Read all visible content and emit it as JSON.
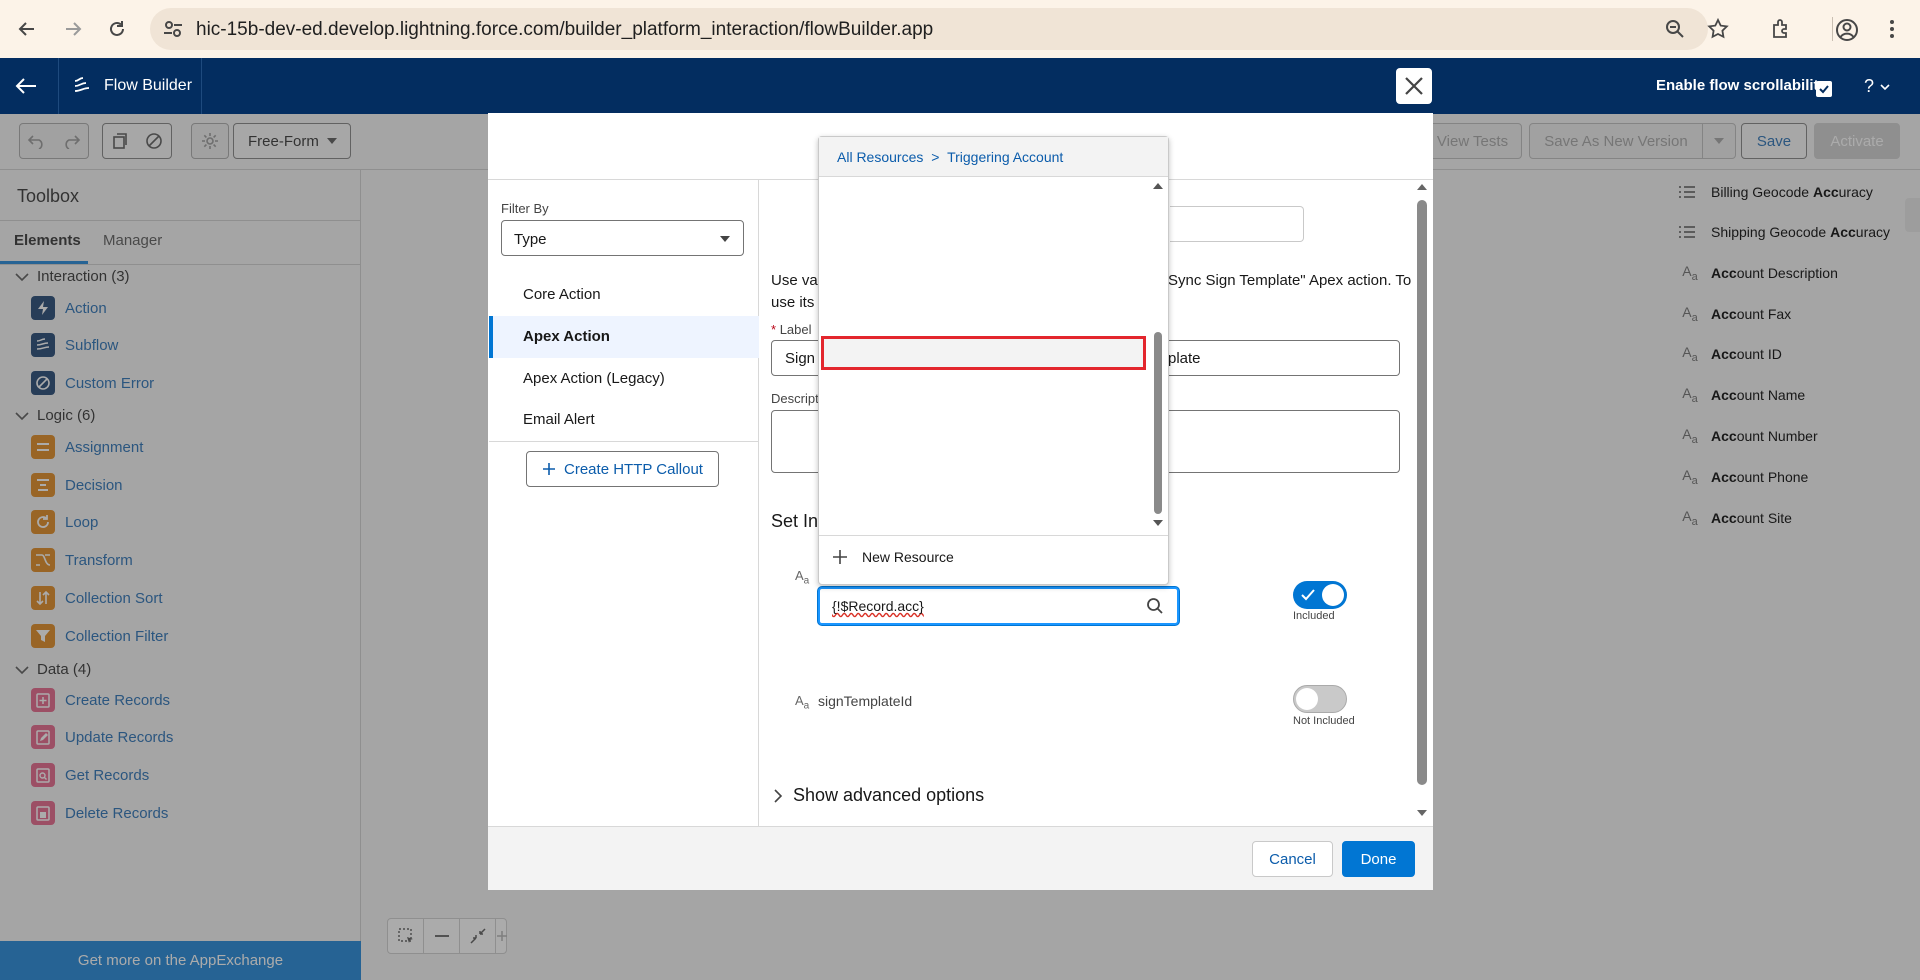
{
  "browser": {
    "url": "hic-15b-dev-ed.develop.lightning.force.com/builder_platform_interaction/flowBuilder.app"
  },
  "header": {
    "app_title": "Flow Builder",
    "scroll_label": "Enable flow scrollability",
    "help_label": "?"
  },
  "toolbar": {
    "layout_select": "Free-Form",
    "view_tests": "View Tests",
    "save_as_new": "Save As New Version",
    "save": "Save",
    "activate": "Activate"
  },
  "toolbox": {
    "title": "Toolbox",
    "tabs": [
      "Elements",
      "Manager"
    ],
    "sections": [
      {
        "label": "Interaction (3)",
        "items": [
          "Action",
          "Subflow",
          "Custom Error"
        ]
      },
      {
        "label": "Logic (6)",
        "items": [
          "Assignment",
          "Decision",
          "Loop",
          "Transform",
          "Collection Sort",
          "Collection Filter"
        ]
      },
      {
        "label": "Data (4)",
        "items": [
          "Create Records",
          "Update Records",
          "Get Records",
          "Delete Records"
        ]
      }
    ],
    "banner": "Get more on the AppExchange"
  },
  "modal": {
    "filter_by_label": "Filter By",
    "filter_value": "Type",
    "categories": [
      "Core Action",
      "Apex Action",
      "Apex Action (Legacy)",
      "Email Alert"
    ],
    "create_callout": "Create HTTP Callout",
    "desc_left": "Use val",
    "desc_left2": "use its",
    "desc_right": "Sync Sign Template\" Apex action. To",
    "label_field_label": "Label",
    "label_value_left": "Sign",
    "label_value_right": "plate",
    "description_label": "Descript",
    "set_inputs": "Set Inp",
    "input_value": "{!$Record.acc}",
    "included_label": "Included",
    "param2": "signTemplateId",
    "not_included_label": "Not Included",
    "advanced": "Show advanced options",
    "cancel": "Cancel",
    "done": "Done"
  },
  "dropdown": {
    "breadcrumb_root": "All Resources",
    "breadcrumb_sep": ">",
    "breadcrumb_current": "Triggering Account",
    "items": [
      {
        "icon": "list-icon",
        "pre": "Billing Geocode ",
        "match": "Acc",
        "post": "uracy"
      },
      {
        "icon": "list-icon",
        "pre": "Shipping Geocode ",
        "match": "Acc",
        "post": "uracy"
      },
      {
        "icon": "text-type-icon",
        "pre": "",
        "match": "Acc",
        "post": "ount Description"
      },
      {
        "icon": "text-type-icon",
        "pre": "",
        "match": "Acc",
        "post": "ount Fax"
      },
      {
        "icon": "text-type-icon",
        "pre": "",
        "match": "Acc",
        "post": "ount ID"
      },
      {
        "icon": "text-type-icon",
        "pre": "",
        "match": "Acc",
        "post": "ount Name"
      },
      {
        "icon": "text-type-icon",
        "pre": "",
        "match": "Acc",
        "post": "ount Number"
      },
      {
        "icon": "text-type-icon",
        "pre": "",
        "match": "Acc",
        "post": "ount Phone"
      },
      {
        "icon": "text-type-icon",
        "pre": "",
        "match": "Acc",
        "post": "ount Site"
      }
    ],
    "new_resource": "New Resource"
  },
  "colors": {
    "brand": "#0176d3",
    "header": "#032d60",
    "highlight_border": "#e3262d"
  }
}
